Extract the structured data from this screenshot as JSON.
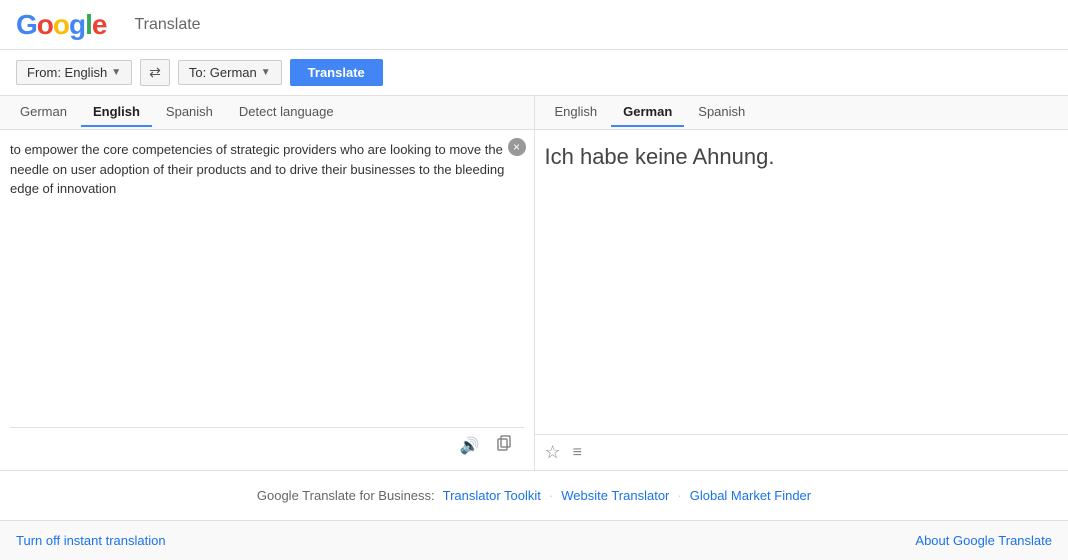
{
  "header": {
    "logo_text": "Google",
    "app_label": "Translate"
  },
  "toolbar": {
    "from_lang_label": "From: English",
    "to_lang_label": "To: German",
    "swap_icon": "⇄",
    "translate_btn_label": "Translate"
  },
  "left_panel": {
    "tabs": [
      {
        "label": "German",
        "active": false
      },
      {
        "label": "English",
        "active": true
      },
      {
        "label": "Spanish",
        "active": false
      },
      {
        "label": "Detect language",
        "active": false
      }
    ],
    "input_text": "to empower the core competencies of strategic providers who are looking to move the needle on user adoption of their products and to drive their businesses to the bleeding edge of innovation",
    "clear_icon": "×",
    "speak_icon": "🔊",
    "copy_icon": "📋"
  },
  "right_panel": {
    "tabs": [
      {
        "label": "English",
        "active": false
      },
      {
        "label": "German",
        "active": true
      },
      {
        "label": "Spanish",
        "active": false
      }
    ],
    "output_text": "Ich habe keine Ahnung.",
    "star_icon": "☆",
    "lines_icon": "≡"
  },
  "business_footer": {
    "label": "Google Translate for Business:",
    "links": [
      {
        "text": "Translator Toolkit"
      },
      {
        "text": "Website Translator"
      },
      {
        "text": "Global Market Finder"
      }
    ]
  },
  "bottom_bar": {
    "instant_translation_label": "Turn off instant translation",
    "about_label": "About Google Translate"
  }
}
